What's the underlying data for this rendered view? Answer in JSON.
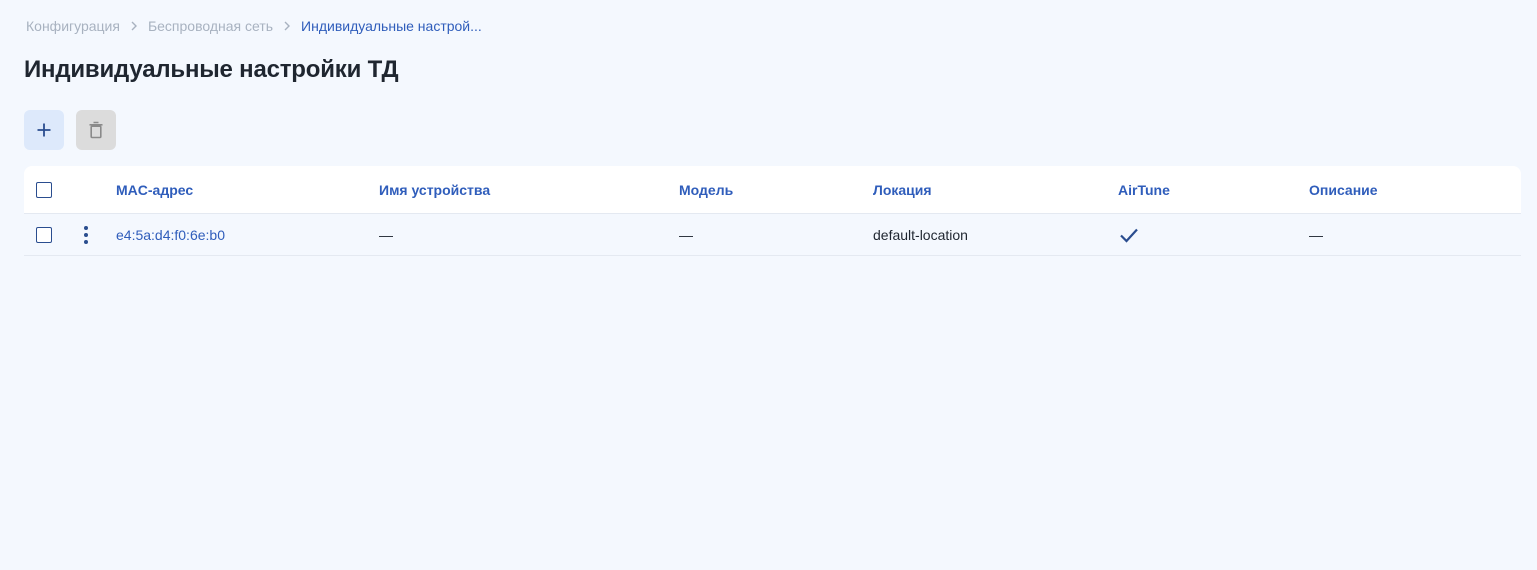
{
  "breadcrumb": {
    "items": [
      "Конфигурация",
      "Беспроводная сеть",
      "Индивидуальные настрой..."
    ]
  },
  "page": {
    "title": "Индивидуальные настройки ТД"
  },
  "toolbar": {
    "add_icon": "plus-icon",
    "delete_icon": "trash-icon"
  },
  "table": {
    "columns": [
      "MAC-адрес",
      "Имя устройства",
      "Модель",
      "Локация",
      "AirTune",
      "Описание"
    ],
    "rows": [
      {
        "mac": "e4:5a:d4:f0:6e:b0",
        "device_name": "—",
        "model": "—",
        "location": "default-location",
        "airtune": "check-icon",
        "description": "—"
      }
    ]
  },
  "colors": {
    "background": "#f4f8fe",
    "accent": "#2f5dbb",
    "title": "#1f2630",
    "muted": "#a8b2c0"
  }
}
